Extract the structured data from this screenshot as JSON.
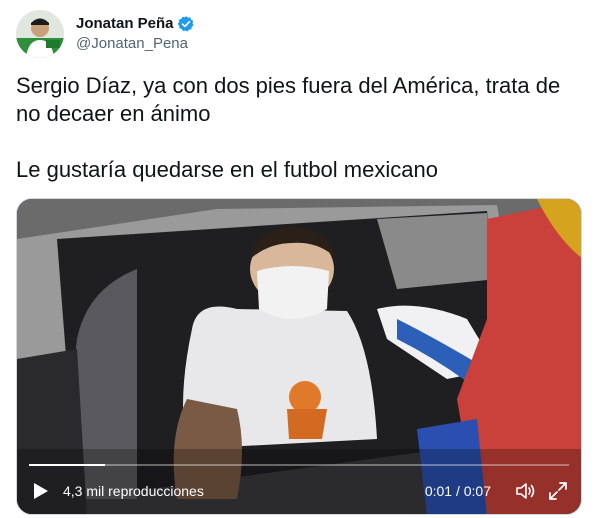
{
  "tweet": {
    "author": {
      "display_name": "Jonatan Peña",
      "handle": "@Jonatan_Pena",
      "verified": true
    },
    "text_lines": [
      "Sergio Díaz, ya con dos pies fuera del América, trata de no decaer en ánimo",
      "Le gustaría quedarse en el futbol mexicano"
    ]
  },
  "video": {
    "views": "4,3 mil reproducciones",
    "time": "0:01 / 0:07",
    "progress": 0.14,
    "icons": {
      "play": "play-icon",
      "volume": "volume-icon",
      "fullscreen": "fullscreen-icon"
    }
  },
  "colors": {
    "verified_blue": "#1d9bf0",
    "handle_gray": "#536471"
  }
}
